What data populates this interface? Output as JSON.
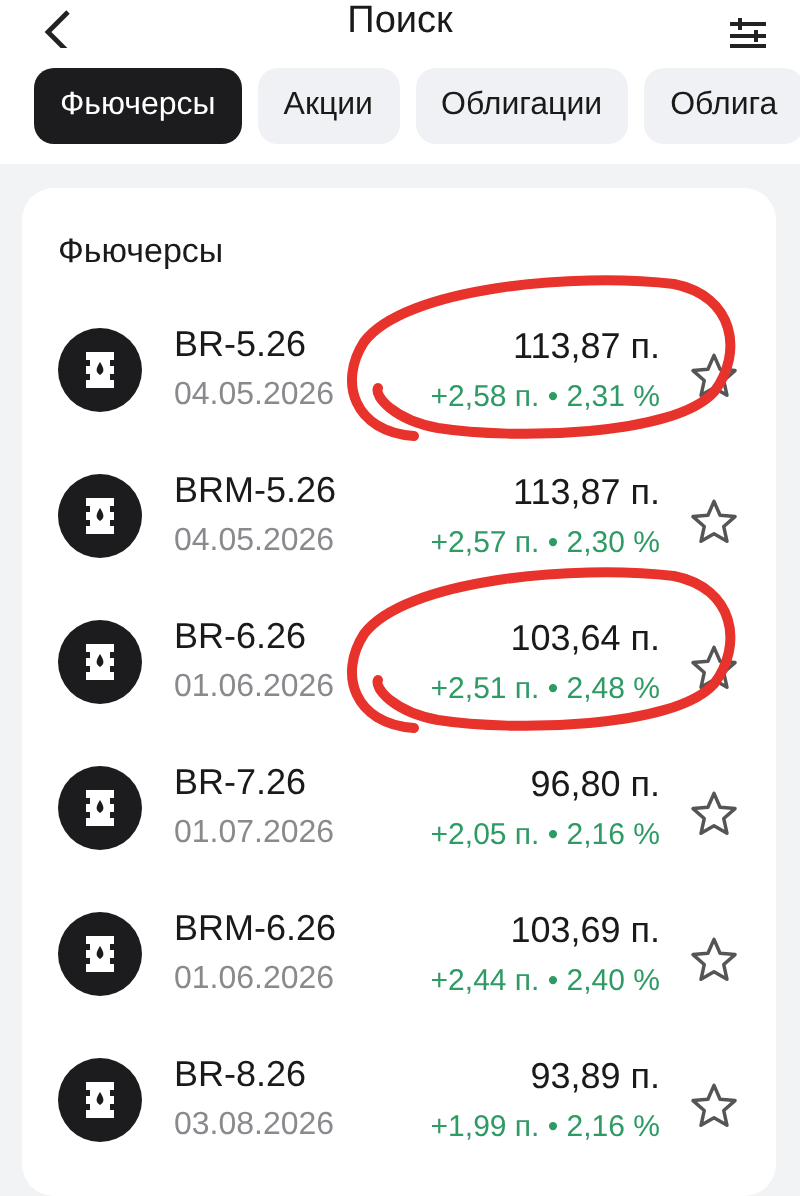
{
  "header": {
    "title": "Поиск"
  },
  "tabs": [
    {
      "label": "Фьючерсы",
      "selected": true
    },
    {
      "label": "Акции",
      "selected": false
    },
    {
      "label": "Облигации",
      "selected": false
    },
    {
      "label": "Облига",
      "selected": false
    }
  ],
  "section": {
    "title": "Фьючерсы",
    "rows": [
      {
        "name": "BR-5.26",
        "date": "04.05.2026",
        "price": "113,87 п.",
        "change": "+2,58 п. • 2,31 %",
        "circled": true
      },
      {
        "name": "BRM-5.26",
        "date": "04.05.2026",
        "price": "113,87 п.",
        "change": "+2,57 п. • 2,30 %",
        "circled": false
      },
      {
        "name": "BR-6.26",
        "date": "01.06.2026",
        "price": "103,64 п.",
        "change": "+2,51 п. • 2,48 %",
        "circled": true
      },
      {
        "name": "BR-7.26",
        "date": "01.07.2026",
        "price": "96,80 п.",
        "change": "+2,05 п. • 2,16 %",
        "circled": false
      },
      {
        "name": "BRM-6.26",
        "date": "01.06.2026",
        "price": "103,69 п.",
        "change": "+2,44 п. • 2,40 %",
        "circled": false
      },
      {
        "name": "BR-8.26",
        "date": "03.08.2026",
        "price": "93,89 п.",
        "change": "+1,99 п. • 2,16 %",
        "circled": false
      }
    ]
  }
}
